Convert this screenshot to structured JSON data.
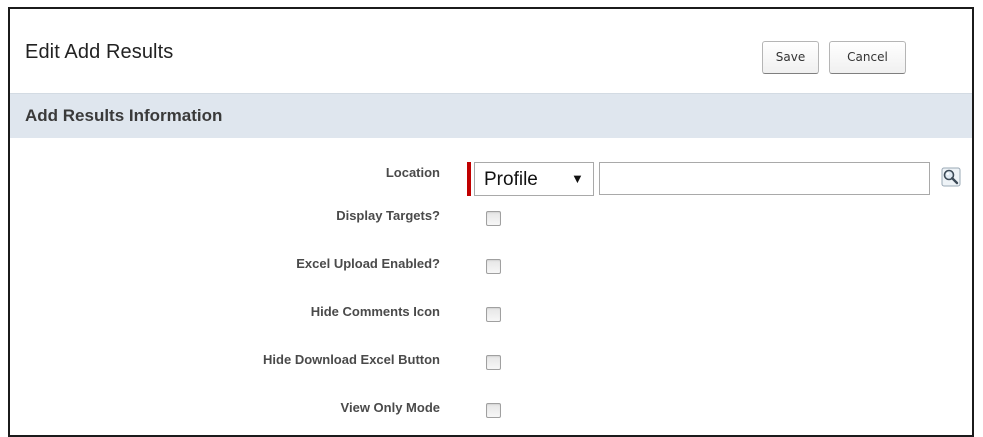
{
  "header": {
    "title": "Edit Add Results",
    "save_label": "Save",
    "cancel_label": "Cancel"
  },
  "section": {
    "title": "Add Results Information"
  },
  "location": {
    "label": "Location",
    "select_value": "Profile",
    "select_arrow": "▼",
    "lookup_value": "",
    "lookup_icon": "magnifier-lookup-icon"
  },
  "fields": [
    {
      "label": "Display Targets?",
      "checked": false
    },
    {
      "label": "Excel Upload Enabled?",
      "checked": false
    },
    {
      "label": "Hide Comments Icon",
      "checked": false
    },
    {
      "label": "Hide Download Excel Button",
      "checked": false
    },
    {
      "label": "View Only Mode",
      "checked": false
    }
  ],
  "colors": {
    "section_bar": "#dfe6ee",
    "required_marker": "#c00000",
    "frame_border": "#1b1b1b"
  }
}
